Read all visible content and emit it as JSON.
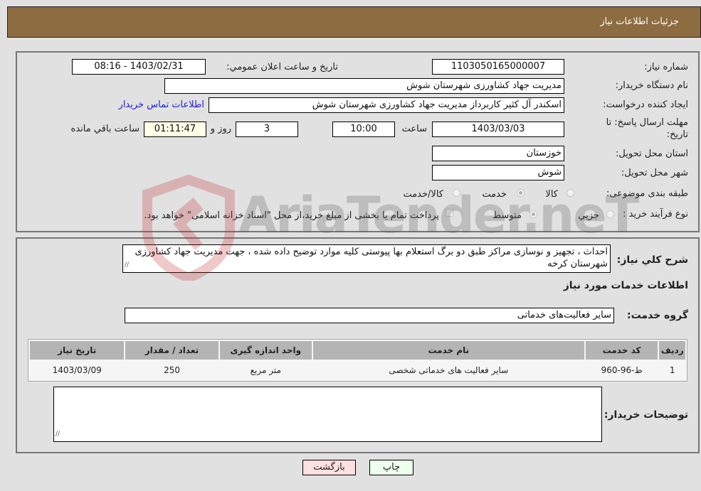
{
  "header": {
    "title": "جزئیات اطلاعات نیاز"
  },
  "form": {
    "need_number": {
      "label": "شماره نیاز:",
      "value": "1103050165000007"
    },
    "announce_datetime": {
      "label": "تاریخ و ساعت اعلان عمومي:",
      "value": "1403/02/31 - 08:16"
    },
    "buyer_org": {
      "label": "نام دستگاه خریدار:",
      "value": "مدیریت جهاد کشاورزی شهرستان شوش"
    },
    "requester": {
      "label": "ایجاد کننده درخواست:",
      "value": "اسکندر آل کثیر کاربرداز مدیریت جهاد کشاورزی شهرستان شوش"
    },
    "buyer_contact_link": "اطلاعات تماس خریدار",
    "deadline": {
      "label_line1": "مهلت ارسال پاسخ: تا",
      "label_line2": "تاریخ:",
      "date": "1403/03/03",
      "time_label": "ساعت",
      "time": "10:00",
      "days": "3",
      "days_label": "روز و",
      "remaining": "01:11:47",
      "remaining_label": "ساعت باقي مانده"
    },
    "province": {
      "label": "استان محل تحویل:",
      "value": "خوزستان"
    },
    "city": {
      "label": "شهر محل تحویل:",
      "value": "شوش"
    },
    "category": {
      "label": "طبقه بندی موضوعی:",
      "options": [
        {
          "label": "کالا",
          "checked": false
        },
        {
          "label": "خدمت",
          "checked": true
        },
        {
          "label": "کالا/خدمت",
          "checked": false
        }
      ]
    },
    "purchase_type": {
      "label": "نوع فرآیند خرید :",
      "options": [
        {
          "label": "جزيي",
          "checked": false
        },
        {
          "label": "متوسط",
          "checked": true
        }
      ],
      "treasury_note": "پرداخت تمام یا بخشی از مبلغ خرید،از محل \"اسناد خزانه اسلامی\" خواهد بود."
    }
  },
  "details": {
    "description_label": "شرح کلي نیاز:",
    "description": "احداث ، تجهیز و نوسازی مراکز طبق دو برگ استعلام بها پیوستی کلیه موارد توضیح داده شده ، جهت مدیریت جهاد کشاورزی شهرستان کرخه",
    "services_heading": "اطلاعات خدمات مورد نیاز",
    "service_group_label": "گروه خدمت:",
    "service_group": "سایر فعالیت‌های خدماتی",
    "table": {
      "headers": [
        "ردیف",
        "کد خدمت",
        "نام خدمت",
        "واحد اندازه گیری",
        "تعداد / مقدار",
        "تاریخ نیاز"
      ],
      "rows": [
        [
          "1",
          "ط-96-960",
          "سایر فعالیت های خدماتی شخصی",
          "متر مربع",
          "250",
          "1403/03/09"
        ]
      ]
    },
    "buyer_notes_label": "توضیحات خریدار:",
    "buyer_notes": ""
  },
  "buttons": {
    "print": "چاپ",
    "back": "بازگشت"
  },
  "watermark": {
    "text": "AriaTender.neT"
  }
}
